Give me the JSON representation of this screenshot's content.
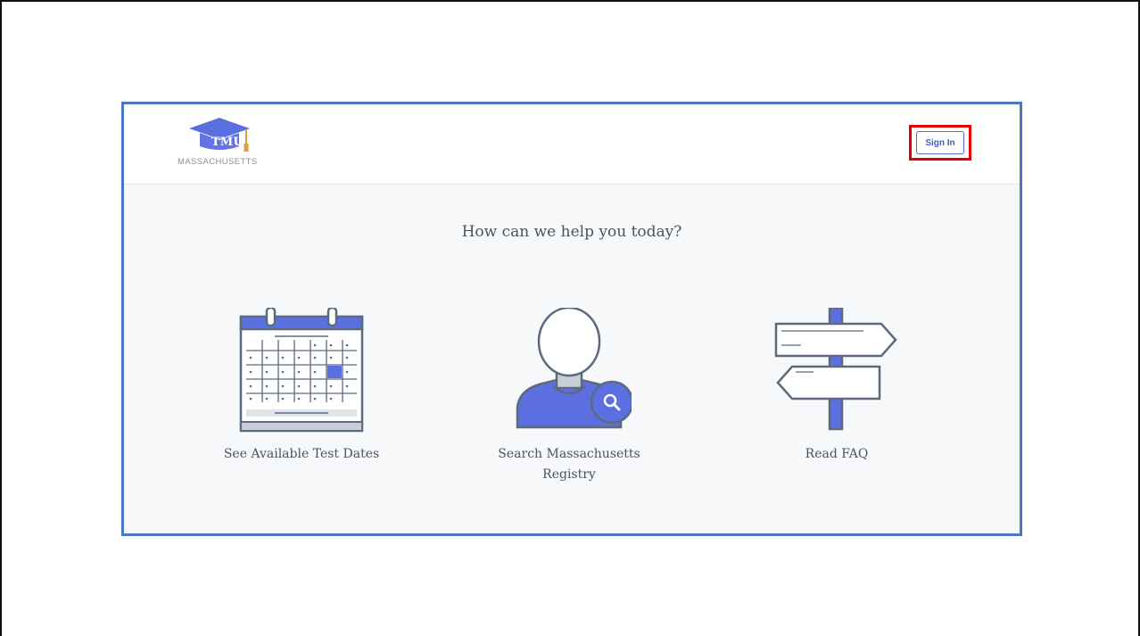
{
  "header": {
    "logo_text": "TMU",
    "logo_subtitle": "MASSACHUSETTS",
    "sign_in_label": "Sign In"
  },
  "main": {
    "heading": "How can we help you today?",
    "cards": [
      {
        "label": "See Available Test Dates",
        "icon": "calendar-icon"
      },
      {
        "label": "Search Massachusetts Registry",
        "icon": "person-search-icon"
      },
      {
        "label": "Read FAQ",
        "icon": "signpost-icon"
      }
    ]
  },
  "colors": {
    "accent": "#5b6fe0",
    "frame": "#4a76c4",
    "highlight": "#e00000",
    "stroke": "#5d6a7e"
  }
}
